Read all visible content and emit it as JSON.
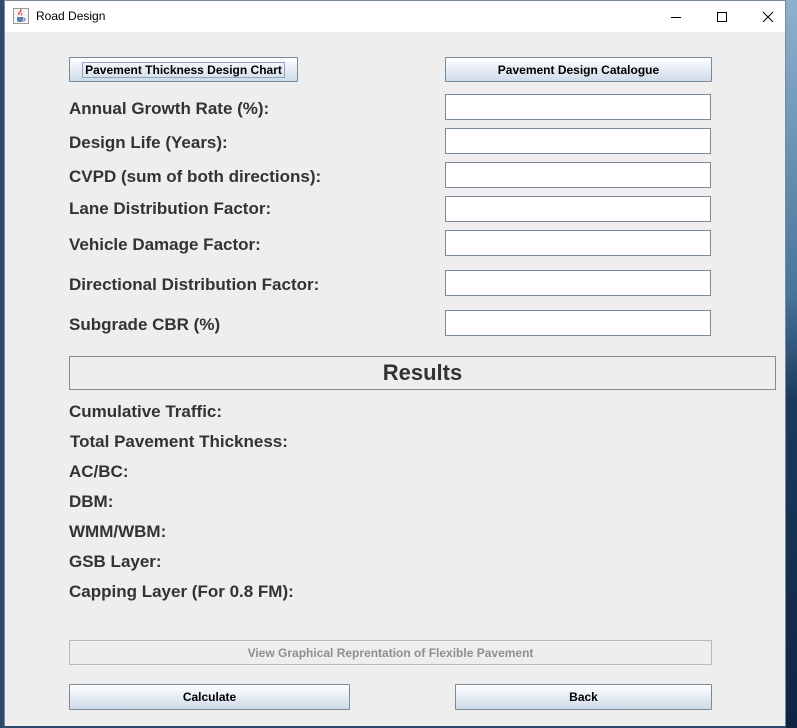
{
  "window": {
    "title": "Road Design",
    "minimize_symbol": "—",
    "maximize_symbol": "☐",
    "close_symbol": "✕"
  },
  "top_buttons": {
    "chart_label": "Pavement Thickness Design Chart",
    "catalogue_label": "Pavement Design Catalogue"
  },
  "inputs": [
    {
      "label": "Annual Growth Rate (%):",
      "value": ""
    },
    {
      "label": "Design Life (Years):",
      "value": ""
    },
    {
      "label": "CVPD (sum of both directions):",
      "value": ""
    },
    {
      "label": "Lane Distribution Factor:",
      "value": ""
    },
    {
      "label": "Vehicle Damage Factor:",
      "value": ""
    },
    {
      "label": "Directional Distribution Factor:",
      "value": ""
    },
    {
      "label": "Subgrade CBR (%)",
      "value": ""
    }
  ],
  "results": {
    "heading": "Results",
    "items": [
      "Cumulative Traffic:",
      "Total Pavement Thickness:",
      "AC/BC:",
      "DBM:",
      "WMM/WBM:",
      "GSB Layer:",
      "Capping Layer (For 0.8 FM):"
    ]
  },
  "bottom_buttons": {
    "view_graphical_label": "View Graphical Reprentation of Flexible Pavement",
    "calculate_label": "Calculate",
    "back_label": "Back"
  },
  "colors": {
    "window_bg": "#eeeeee",
    "text": "#333333",
    "button_border": "#7a8a99",
    "disabled_text": "#8f8f8f"
  },
  "icons": {
    "app": "java-coffee-cup-icon"
  }
}
